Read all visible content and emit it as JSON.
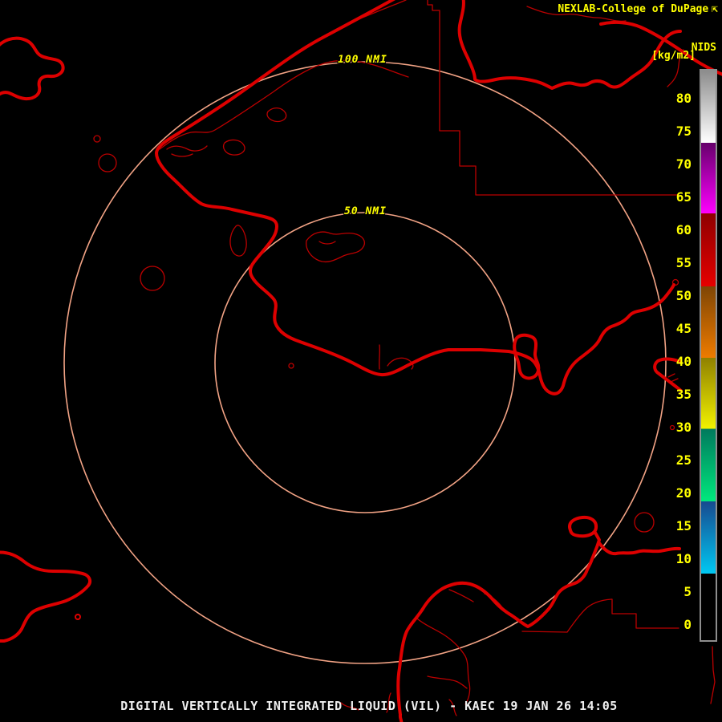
{
  "header": {
    "brand": "NEXLAB-College of DuPage",
    "brand_icon": "⇱",
    "network_label": "NIDS",
    "units_label": "[kg/m2]"
  },
  "range_rings": {
    "outer_label": "100 NMI",
    "inner_label": "50 NMI"
  },
  "colorbar": {
    "unit": "kg/m2",
    "tick_values": [
      80,
      75,
      70,
      65,
      60,
      55,
      50,
      45,
      40,
      35,
      30,
      25,
      20,
      15,
      10,
      5,
      0
    ],
    "segments": [
      {
        "top_color": "#8c8c8c",
        "bottom_color": "#ffffff",
        "from_pct": 0,
        "to_pct": 12.7
      },
      {
        "top_color": "#66006b",
        "bottom_color": "#ff00ff",
        "from_pct": 12.7,
        "to_pct": 25.1
      },
      {
        "top_color": "#8e0000",
        "bottom_color": "#e60000",
        "from_pct": 25.1,
        "to_pct": 37.9
      },
      {
        "top_color": "#7e4505",
        "bottom_color": "#ee7b00",
        "from_pct": 37.9,
        "to_pct": 50.4
      },
      {
        "top_color": "#8f8000",
        "bottom_color": "#f2f200",
        "from_pct": 50.4,
        "to_pct": 62.9
      },
      {
        "top_color": "#00795d",
        "bottom_color": "#00e87d",
        "from_pct": 62.9,
        "to_pct": 75.6
      },
      {
        "top_color": "#17498f",
        "bottom_color": "#00c8f2",
        "from_pct": 75.6,
        "to_pct": 88.3
      },
      {
        "top_color": "#000000",
        "bottom_color": "#000000",
        "from_pct": 88.3,
        "to_pct": 100
      }
    ]
  },
  "footer": {
    "caption": "DIGITAL VERTICALLY INTEGRATED LIQUID (VIL) - KAEC 19 JAN 26 14:05"
  },
  "colors": {
    "background": "#000000",
    "map_outline": "#dd0000",
    "map_outline_thin": "#bb0000",
    "range_ring": "#f2a385",
    "label_yellow": "#ffff00",
    "caption_white": "#f0f0f0",
    "colorbar_border": "#8e8e8e"
  }
}
